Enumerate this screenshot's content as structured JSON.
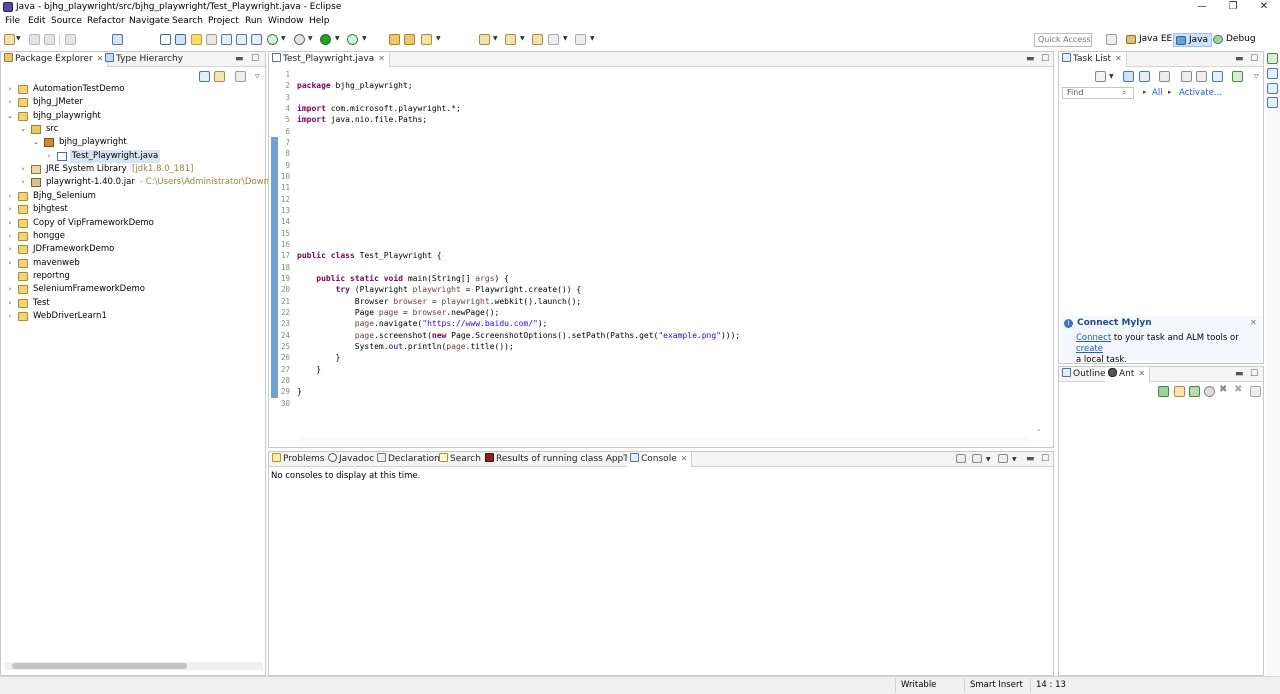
{
  "window": {
    "title": "Java - bjhg_playwright/src/bjhg_playwright/Test_Playwright.java - Eclipse",
    "minimize": "—",
    "maximize": "❐",
    "close": "✕"
  },
  "menu": [
    "File",
    "Edit",
    "Source",
    "Refactor",
    "Navigate",
    "Search",
    "Project",
    "Run",
    "Window",
    "Help"
  ],
  "toolbar": {
    "quick_access_placeholder": "Quick Access",
    "perspectives": [
      "Java EE",
      "Java",
      "Debug"
    ],
    "active_perspective": "Java"
  },
  "package_explorer": {
    "tabs": [
      "Package Explorer",
      "Type Hierarchy"
    ],
    "items": [
      {
        "label": "AutomationTestDemo",
        "level": 0,
        "expanded": false,
        "icon": "project-icon"
      },
      {
        "label": "bjhg_JMeter",
        "level": 0,
        "expanded": false,
        "icon": "project-icon"
      },
      {
        "label": "bjhg_playwright",
        "level": 0,
        "expanded": true,
        "icon": "project-icon"
      },
      {
        "label": "src",
        "level": 1,
        "expanded": true,
        "icon": "source-folder-icon"
      },
      {
        "label": "bjhg_playwright",
        "level": 2,
        "expanded": true,
        "icon": "package-icon"
      },
      {
        "label": "Test_Playwright.java",
        "level": 3,
        "expanded": false,
        "icon": "java-file-icon",
        "selected": true
      },
      {
        "label": "JRE System Library",
        "extra": "[jdk1.8.0_181]",
        "level": 1,
        "expanded": false,
        "icon": "library-icon"
      },
      {
        "label": "playwright-1.40.0.jar",
        "extra": "- C:\\Users\\Administrator\\Downloads",
        "level": 1,
        "expanded": false,
        "icon": "jar-icon"
      },
      {
        "label": "Bjhg_Selenium",
        "level": 0,
        "expanded": false,
        "icon": "project-icon"
      },
      {
        "label": "bjhgtest",
        "level": 0,
        "expanded": false,
        "icon": "project-icon"
      },
      {
        "label": "Copy of VipFrameworkDemo",
        "level": 0,
        "expanded": false,
        "icon": "project-icon"
      },
      {
        "label": "hongge",
        "level": 0,
        "expanded": false,
        "icon": "project-icon"
      },
      {
        "label": "JDFrameworkDemo",
        "level": 0,
        "expanded": false,
        "icon": "project-icon"
      },
      {
        "label": "mavenweb",
        "level": 0,
        "expanded": false,
        "icon": "project-icon"
      },
      {
        "label": "reportng",
        "level": 0,
        "expanded": null,
        "icon": "project-icon"
      },
      {
        "label": "SeleniumFrameworkDemo",
        "level": 0,
        "expanded": false,
        "icon": "project-icon"
      },
      {
        "label": "Test",
        "level": 0,
        "expanded": false,
        "icon": "project-icon"
      },
      {
        "label": "WebDriverLearn1",
        "level": 0,
        "expanded": false,
        "icon": "project-icon"
      }
    ]
  },
  "editor": {
    "tab_label": "Test_Playwright.java",
    "line_numbers": [
      "1",
      "2",
      "3",
      "4",
      "5",
      "6",
      "7",
      "8",
      "9",
      "10",
      "11",
      "12",
      "13",
      "14",
      "15",
      "16",
      "17",
      "18",
      "19",
      "20",
      "21",
      "22",
      "23",
      "24",
      "25",
      "26",
      "27",
      "28",
      "29",
      "30"
    ],
    "code_lines": [
      "",
      "package bjhg_playwright;",
      "",
      "import com.microsoft.playwright.*;",
      "import java.nio.file.Paths;",
      "",
      "",
      "",
      "",
      "",
      "",
      "",
      "",
      "",
      "",
      "",
      "public class Test_Playwright {",
      "",
      "    public static void main(String[] args) {",
      "        try (Playwright playwright = Playwright.create()) {",
      "            Browser browser = playwright.webkit().launch();",
      "            Page page = browser.newPage();",
      "            page.navigate(\"https://www.baidu.com/\");",
      "            page.screenshot(new Page.ScreenshotOptions().setPath(Paths.get(\"example.png\")));",
      "            System.out.println(page.title());",
      "        }",
      "    }",
      "",
      "}",
      ""
    ]
  },
  "bottom_panel": {
    "tabs": [
      "Problems",
      "Javadoc",
      "Declaration",
      "Search",
      "Results of running class AppTest",
      "Console"
    ],
    "active_tab": "Console",
    "message": "No consoles to display at this time."
  },
  "task_list": {
    "tab_label": "Task List",
    "find_placeholder": "Find",
    "all_label": "All",
    "activate_label": "Activate..."
  },
  "mylyn": {
    "title": "Connect Mylyn",
    "connect_link": "Connect",
    "text_mid": " to your task and ALM tools or ",
    "create_link": "create",
    "text_end": "a local task."
  },
  "outline_panel": {
    "tabs": [
      "Outline",
      "Ant"
    ]
  },
  "status_bar": {
    "writable": "Writable",
    "insert_mode": "Smart Insert",
    "position": "14 : 13"
  }
}
